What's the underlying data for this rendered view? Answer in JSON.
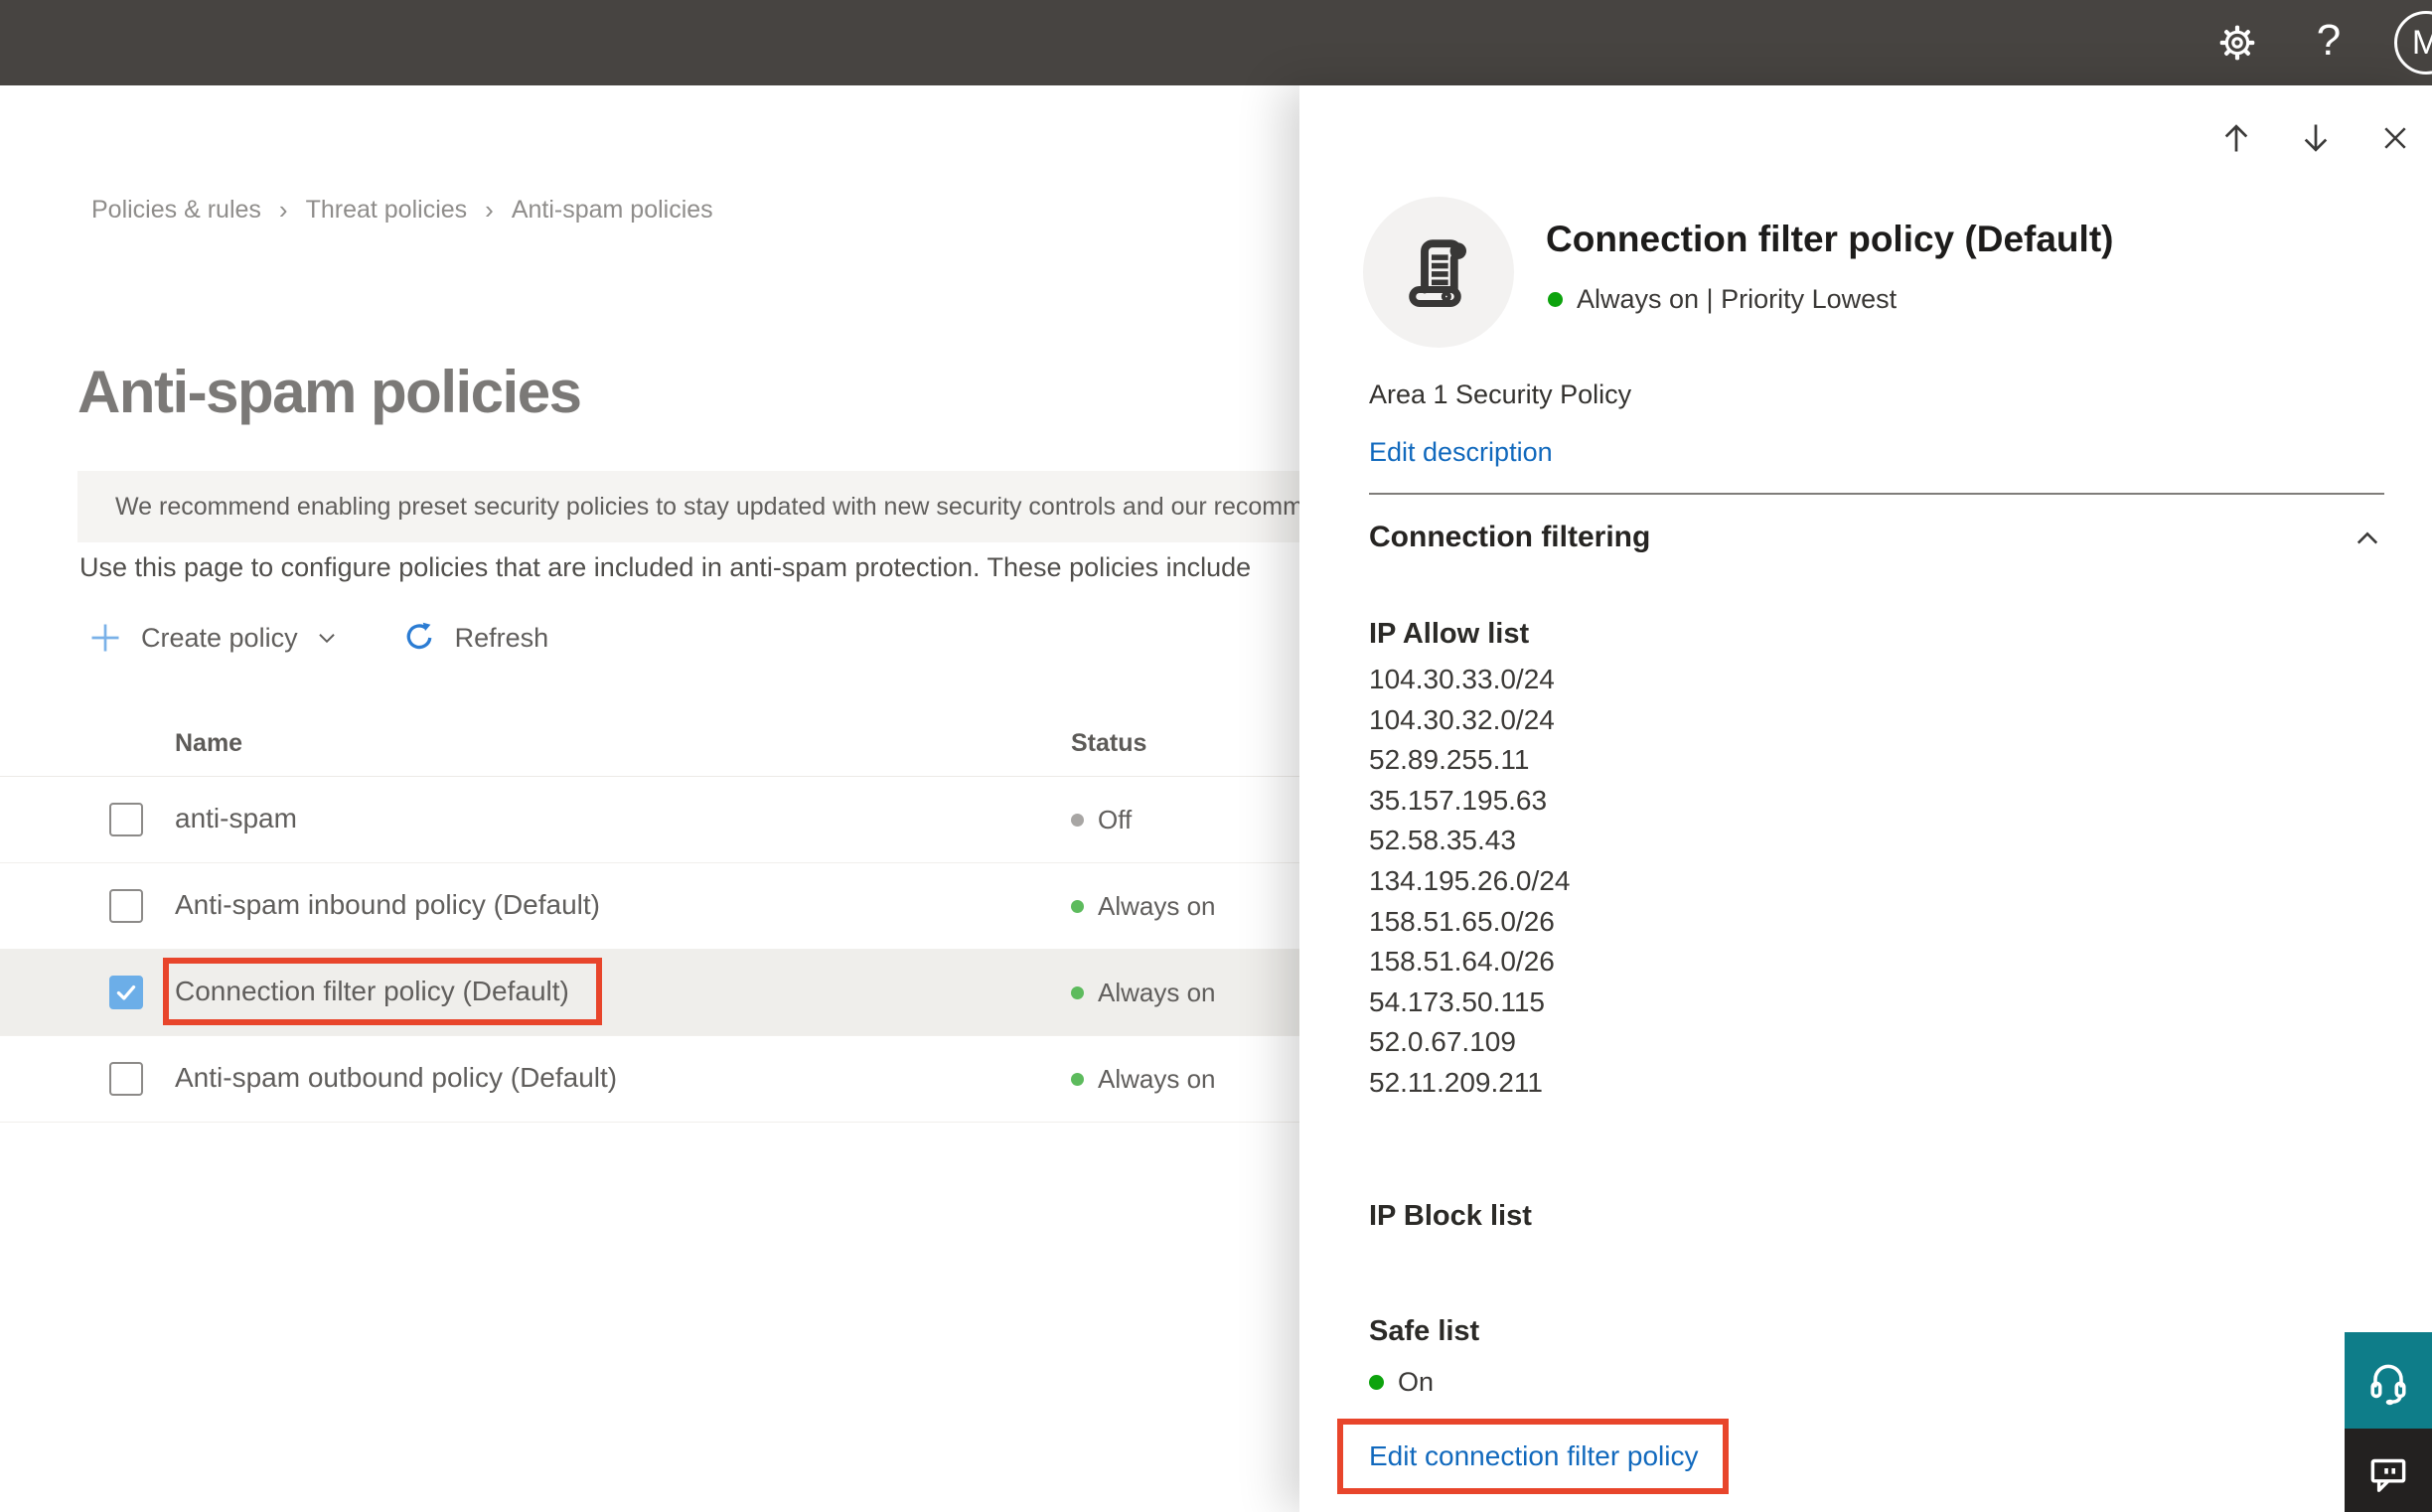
{
  "topbar": {
    "help_glyph": "?",
    "avatar_initial": "M"
  },
  "breadcrumb": {
    "separator": "›",
    "items": [
      "Policies & rules",
      "Threat policies",
      "Anti-spam policies"
    ]
  },
  "page": {
    "title": "Anti-spam policies",
    "banner_text": "We recommend enabling preset security policies to stay updated with new security controls and our recomme",
    "description": "Use this page to configure policies that are included in anti-spam protection. These policies include",
    "toolbar": {
      "create_policy": "Create policy",
      "refresh": "Refresh"
    }
  },
  "table": {
    "headers": {
      "name": "Name",
      "status": "Status"
    },
    "rows": [
      {
        "name": "anti-spam",
        "status": "Off",
        "dot_color": "#a8a6a4",
        "checked": false,
        "selected": false
      },
      {
        "name": "Anti-spam inbound policy (Default)",
        "status": "Always on",
        "dot_color": "#5dbb5d",
        "checked": false,
        "selected": false
      },
      {
        "name": "Connection filter policy (Default)",
        "status": "Always on",
        "dot_color": "#5dbb5d",
        "checked": true,
        "selected": true
      },
      {
        "name": "Anti-spam outbound policy (Default)",
        "status": "Always on",
        "dot_color": "#5dbb5d",
        "checked": false,
        "selected": false
      }
    ]
  },
  "panel": {
    "title": "Connection filter policy (Default)",
    "status_line": "Always on | Priority Lowest",
    "status_dot_color": "#0da30d",
    "policy_description": "Area 1 Security Policy",
    "edit_description_label": "Edit description",
    "section_title": "Connection filtering",
    "ip_allow_title": "IP Allow list",
    "ip_allow_items": [
      "104.30.33.0/24",
      "104.30.32.0/24",
      "52.89.255.11",
      "35.157.195.63",
      "52.58.35.43",
      "134.195.26.0/24",
      "158.51.65.0/26",
      "158.51.64.0/26",
      "54.173.50.115",
      "52.0.67.109",
      "52.11.209.211"
    ],
    "ip_block_title": "IP Block list",
    "safe_list_title": "Safe list",
    "safe_list_value": "On",
    "safe_list_dot_color": "#0da30d",
    "edit_link_label": "Edit connection filter policy"
  },
  "colors": {
    "annotation_red": "#e8452b",
    "link_blue": "#1169bd",
    "checkbox_checked_blue": "#6caee8",
    "topbar_dark": "#474441",
    "headset_button_teal": "#0e7d89",
    "chat_button_dark": "#232120"
  }
}
